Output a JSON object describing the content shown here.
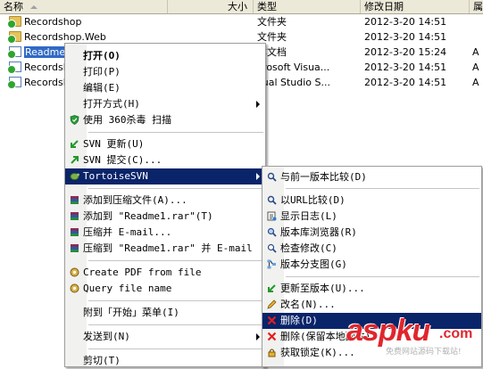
{
  "columns": {
    "name": "名称",
    "size": "大小",
    "type": "类型",
    "modified": "修改日期",
    "attr": "属"
  },
  "files": [
    {
      "name": "Recordshop",
      "type": "文件夹",
      "date": "2012-3-20 14:51",
      "attr": ""
    },
    {
      "name": "Recordshop.Web",
      "type": "文件夹",
      "date": "2012-3-20 14:51",
      "attr": ""
    },
    {
      "name": "Readme1.",
      "type": "本文档",
      "date": "2012-3-20 15:24",
      "attr": "A"
    },
    {
      "name": "Recordsh",
      "type": "crosoft Visua...",
      "date": "2012-3-20 14:51",
      "attr": "A"
    },
    {
      "name": "Recordsh",
      "type": "sual Studio S...",
      "date": "2012-3-20 14:51",
      "attr": "A"
    }
  ],
  "context_menu": {
    "open": "打开(O)",
    "print": "打印(P)",
    "edit": "编辑(E)",
    "open_with": "打开方式(H)",
    "scan_360": "使用 360杀毒 扫描",
    "svn_update": "SVN 更新(U)",
    "svn_commit": "SVN 提交(C)...",
    "tortoise_svn": "TortoiseSVN",
    "add_archive": "添加到压缩文件(A)...",
    "add_rar": "添加到 \"Readme1.rar\"(T)",
    "zip_email": "压缩并 E-mail...",
    "zip_rar_email": "压缩到 \"Readme1.rar\" 并 E-mail",
    "create_pdf": "Create PDF from file",
    "query_name": "Query file name",
    "pin_start": "附到「开始」菜单(I)",
    "send_to": "发送到(N)",
    "cut": "剪切(T)"
  },
  "svn_submenu": {
    "diff_prev": "与前一版本比较(D)",
    "diff_url": "以URL比较(D)",
    "show_log": "显示日志(L)",
    "repo_browser": "版本库浏览器(R)",
    "check_mod": "检查修改(C)",
    "rev_graph": "版本分支图(G)",
    "update_rev": "更新至版本(U)...",
    "rename": "改名(N)...",
    "delete": "删除(D)",
    "delete_keep": "删除(保留本地副本)",
    "get_lock": "获取锁定(K)..."
  },
  "watermark": {
    "brand": "aspku",
    "domain": ".com",
    "tagline": "免费网站源码下载站!"
  },
  "colors": {
    "highlight": "#0a246a",
    "watermark_red": "#e0262d"
  }
}
